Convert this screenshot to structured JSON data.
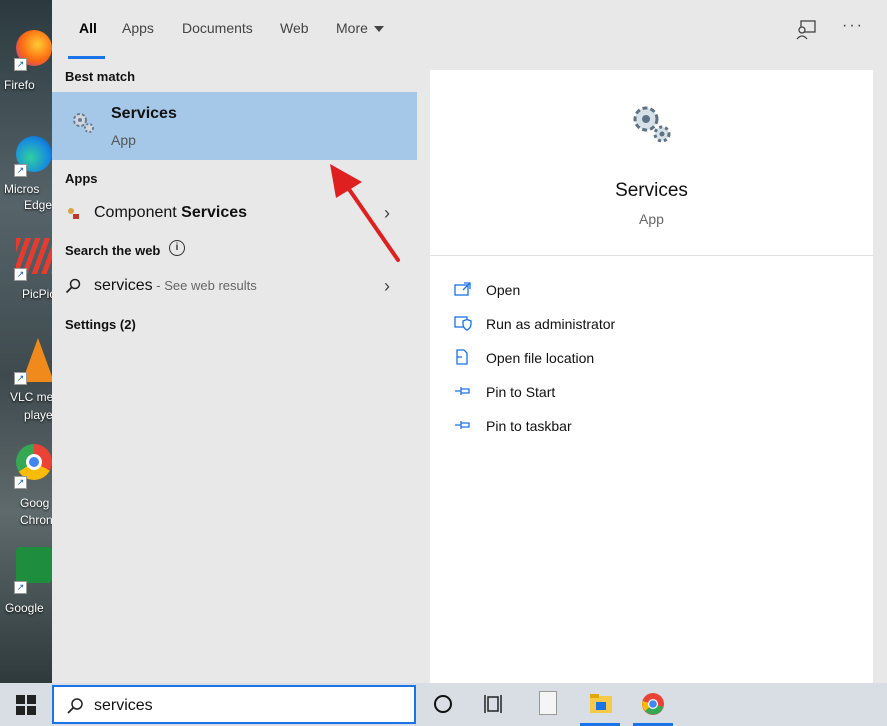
{
  "desktop": {
    "icons": [
      {
        "label": "Firefo",
        "icon": "firefox-icon"
      },
      {
        "label": "Micros",
        "label2": "Edge",
        "icon": "edge-icon"
      },
      {
        "label": "PicPic",
        "icon": "picpick-icon"
      },
      {
        "label": "VLC me",
        "label2": "playe",
        "icon": "vlc-icon"
      },
      {
        "label": "Goog",
        "label2": "Chron",
        "icon": "chrome-icon"
      },
      {
        "label": "Google",
        "icon": "google-sheets-icon"
      }
    ]
  },
  "tabs": {
    "all": "All",
    "apps": "Apps",
    "documents": "Documents",
    "web": "Web",
    "more": "More",
    "more_dots": "···"
  },
  "results": {
    "best_match_heading": "Best match",
    "best_match": {
      "title": "Services",
      "subtitle": "App",
      "icon": "services-gear-icon"
    },
    "apps_heading": "Apps",
    "app_item": {
      "prefix": "Component ",
      "match": "Services",
      "icon": "component-services-icon"
    },
    "web_heading": "Search the web",
    "web_item": {
      "term": "services",
      "hint": " - See web results"
    },
    "settings_heading": "Settings (2)"
  },
  "preview": {
    "title": "Services",
    "subtitle": "App",
    "actions": [
      {
        "label": "Open",
        "icon": "open-icon"
      },
      {
        "label": "Run as administrator",
        "icon": "shield-icon"
      },
      {
        "label": "Open file location",
        "icon": "folder-location-icon"
      },
      {
        "label": "Pin to Start",
        "icon": "pin-icon"
      },
      {
        "label": "Pin to taskbar",
        "icon": "pin-icon"
      }
    ]
  },
  "taskbar": {
    "search_value": "services"
  },
  "colors": {
    "highlight": "#a6c8e8",
    "accent": "#1a73e8",
    "arrow": "#e02020"
  }
}
